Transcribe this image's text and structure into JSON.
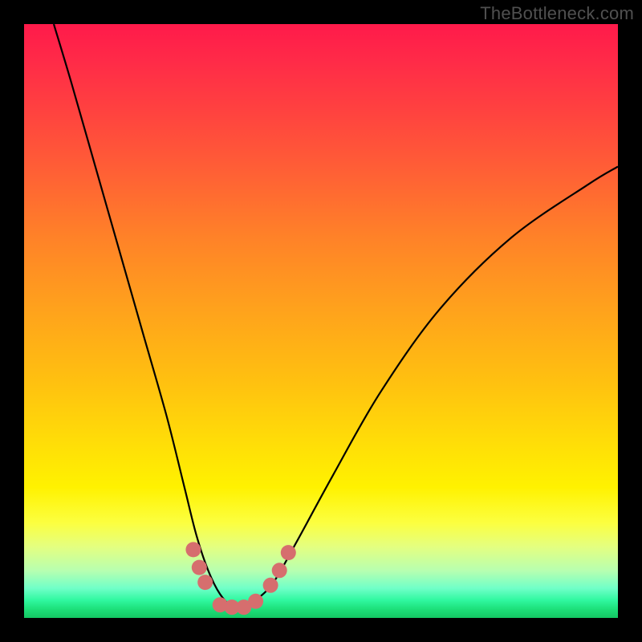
{
  "watermark": "TheBottleneck.com",
  "colors": {
    "frame": "#000000",
    "curve_stroke": "#000000",
    "marker_fill": "#d66e6e",
    "marker_stroke": "#c85a5a"
  },
  "chart_data": {
    "type": "line",
    "title": "",
    "xlabel": "",
    "ylabel": "",
    "xlim": [
      0,
      100
    ],
    "ylim": [
      0,
      100
    ],
    "grid": false,
    "series": [
      {
        "name": "bottleneck-curve",
        "x": [
          5,
          8,
          12,
          16,
          20,
          24,
          27,
          29,
          31,
          33,
          35,
          37,
          39,
          42,
          46,
          52,
          60,
          70,
          82,
          95,
          100
        ],
        "y": [
          100,
          90,
          76,
          62,
          48,
          34,
          22,
          14,
          8,
          4,
          2,
          2,
          3,
          6,
          13,
          24,
          38,
          52,
          64,
          73,
          76
        ]
      }
    ],
    "markers": [
      {
        "x": 28.5,
        "y": 11.5
      },
      {
        "x": 29.5,
        "y": 8.5
      },
      {
        "x": 30.5,
        "y": 6.0
      },
      {
        "x": 33.0,
        "y": 2.2
      },
      {
        "x": 35.0,
        "y": 1.8
      },
      {
        "x": 37.0,
        "y": 1.8
      },
      {
        "x": 39.0,
        "y": 2.8
      },
      {
        "x": 41.5,
        "y": 5.5
      },
      {
        "x": 43.0,
        "y": 8.0
      },
      {
        "x": 44.5,
        "y": 11.0
      }
    ],
    "annotations": []
  }
}
